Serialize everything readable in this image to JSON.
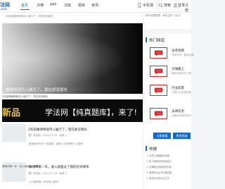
{
  "header": {
    "brand": "法网",
    "brand_sub": "学法网",
    "nav": [
      "首页",
      "法律",
      "APP",
      "法属",
      "题库",
      "考场"
    ],
    "tools": [
      "手机端",
      "搜索",
      "登录",
      "注册"
    ]
  },
  "main": {
    "ticker": "2年前我做律师就月入破万了，现在却没增长",
    "hero": {
      "caption": "做律师就月入破万了，现在却没增长"
    },
    "promo": {
      "side_caption": "2年前做律师就月入破万了，现在却没增长",
      "badge": "新品",
      "headline": "学法网【纯真题库】，来了!"
    },
    "articles": [
      {
        "title": "2年前做律师就月入破万了，现在却没增长",
        "source": "学法网  ·  2021-07-29  ·  阅读  2",
        "excerpt": "做律师多年的一些感想，给刚入行的律师一点参考"
      },
      {
        "image_caption": "做律师第一年，收入就超过了我的",
        "title": "做律师第一年，收入就超过了我的东导律师",
        "source": "学法网  ·  2021-07-29  ·  阅读  3",
        "excerpt": "入行律师第一年的收入情况"
      }
    ]
  },
  "sidebar": {
    "top_text": "随手收集整理，每天进步一点点！",
    "channels_title": "热门频道",
    "channels": [
      {
        "name": "法考指南",
        "desc": "法考资讯、备考攻略"
      },
      {
        "name": "大咖路上",
        "desc": "律师名家成长之路"
      },
      {
        "name": "行业前景",
        "desc": "法律行业发展前景"
      },
      {
        "name": "法律实务",
        "desc": "法律实务操作技巧"
      }
    ],
    "buttons": [
      "立即查看",
      "更多频道"
    ],
    "hot_title": "热搜",
    "hot_items": [
      "1. 法考主观题备考攻略",
      "2. 新人律师如何快速成长",
      "3. 法律职业资格考试时间",
      "4. 律师执业证书办理流程",
      "5. 刑法重点知识点汇总"
    ]
  }
}
